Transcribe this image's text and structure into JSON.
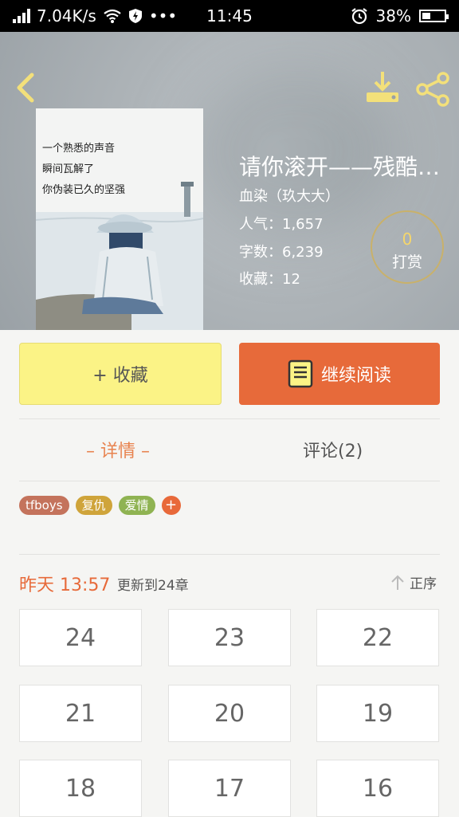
{
  "status_bar": {
    "speed": "7.04K/s",
    "time": "11:45",
    "battery": "38%",
    "battery_level": 0.38,
    "more": "•••"
  },
  "book": {
    "title": "请你滚开——残酷…",
    "author": "血染（玖大大）",
    "popularity": "人气：1,657",
    "word_count": "字数：6,239",
    "favorites": "收藏：12"
  },
  "cover": {
    "lines": [
      "一个熟悉的声音",
      "瞬间瓦解了",
      "你伪装已久的坚强"
    ]
  },
  "tip": {
    "count": "0",
    "label": "打赏"
  },
  "actions": {
    "collect_label": "+ 收藏",
    "read_label": "继续阅读"
  },
  "tabs": {
    "detail": "– 详情 –",
    "comments": "评论(2)"
  },
  "tags": [
    {
      "label": "tfboys",
      "color": "#c4735c"
    },
    {
      "label": "复仇",
      "color": "#cfa43a"
    },
    {
      "label": "爱情",
      "color": "#8fb352"
    }
  ],
  "tag_add": "+",
  "update": {
    "time": "昨天 13:57",
    "text": "更新到24章",
    "sort_label": "正序"
  },
  "chapters": [
    "24",
    "23",
    "22",
    "21",
    "20",
    "19",
    "18",
    "17",
    "16"
  ],
  "colors": {
    "accent": "#e76a3a",
    "collect_bg": "#fbf386",
    "icon_yellow": "#f3e07a"
  },
  "icons": [
    "back-icon",
    "download-icon",
    "share-icon",
    "book-icon",
    "arrow-up-icon",
    "wifi-icon",
    "signal-icon",
    "shield-icon",
    "alarm-icon",
    "battery-icon"
  ]
}
